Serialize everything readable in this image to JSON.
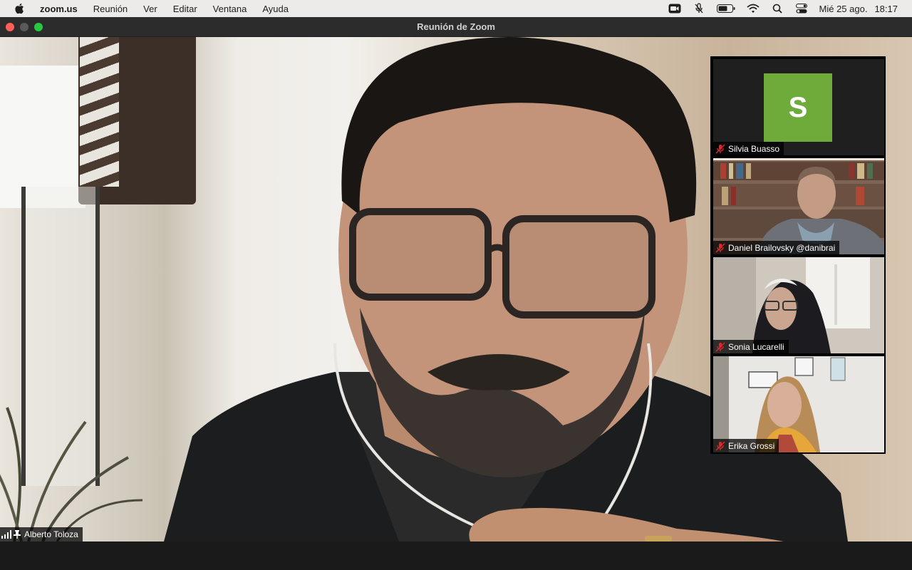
{
  "menubar": {
    "app_name": "zoom.us",
    "items": [
      "Reunión",
      "Ver",
      "Editar",
      "Ventana",
      "Ayuda"
    ],
    "date": "Mié 25 ago.",
    "time": "18:17",
    "status_icons": [
      "zoom-camera-icon",
      "mic-off-icon",
      "battery-icon",
      "wifi-icon",
      "search-icon",
      "control-center-icon"
    ]
  },
  "window": {
    "title": "Reunión de Zoom"
  },
  "main_video": {
    "participant_name": "Alberto Toloza",
    "icons": [
      "signal-icon",
      "pin-icon"
    ]
  },
  "gallery": {
    "participants": [
      {
        "name": "Silvia Buasso",
        "avatar_letter": "S",
        "avatar_color": "#6fab3b",
        "muted": true,
        "video": false
      },
      {
        "name": "Daniel Brailovsky @danibrai",
        "muted": true,
        "video": true
      },
      {
        "name": "Sonia Lucarelli",
        "muted": true,
        "video": true
      },
      {
        "name": "Erika Grossi",
        "muted": true,
        "video": true
      }
    ]
  },
  "colors": {
    "menubar_bg": "#ecebe9",
    "titlebar_bg": "#2c2c2c",
    "close": "#fe5f57",
    "maximize": "#28c840",
    "muted_red": "#e02828"
  }
}
